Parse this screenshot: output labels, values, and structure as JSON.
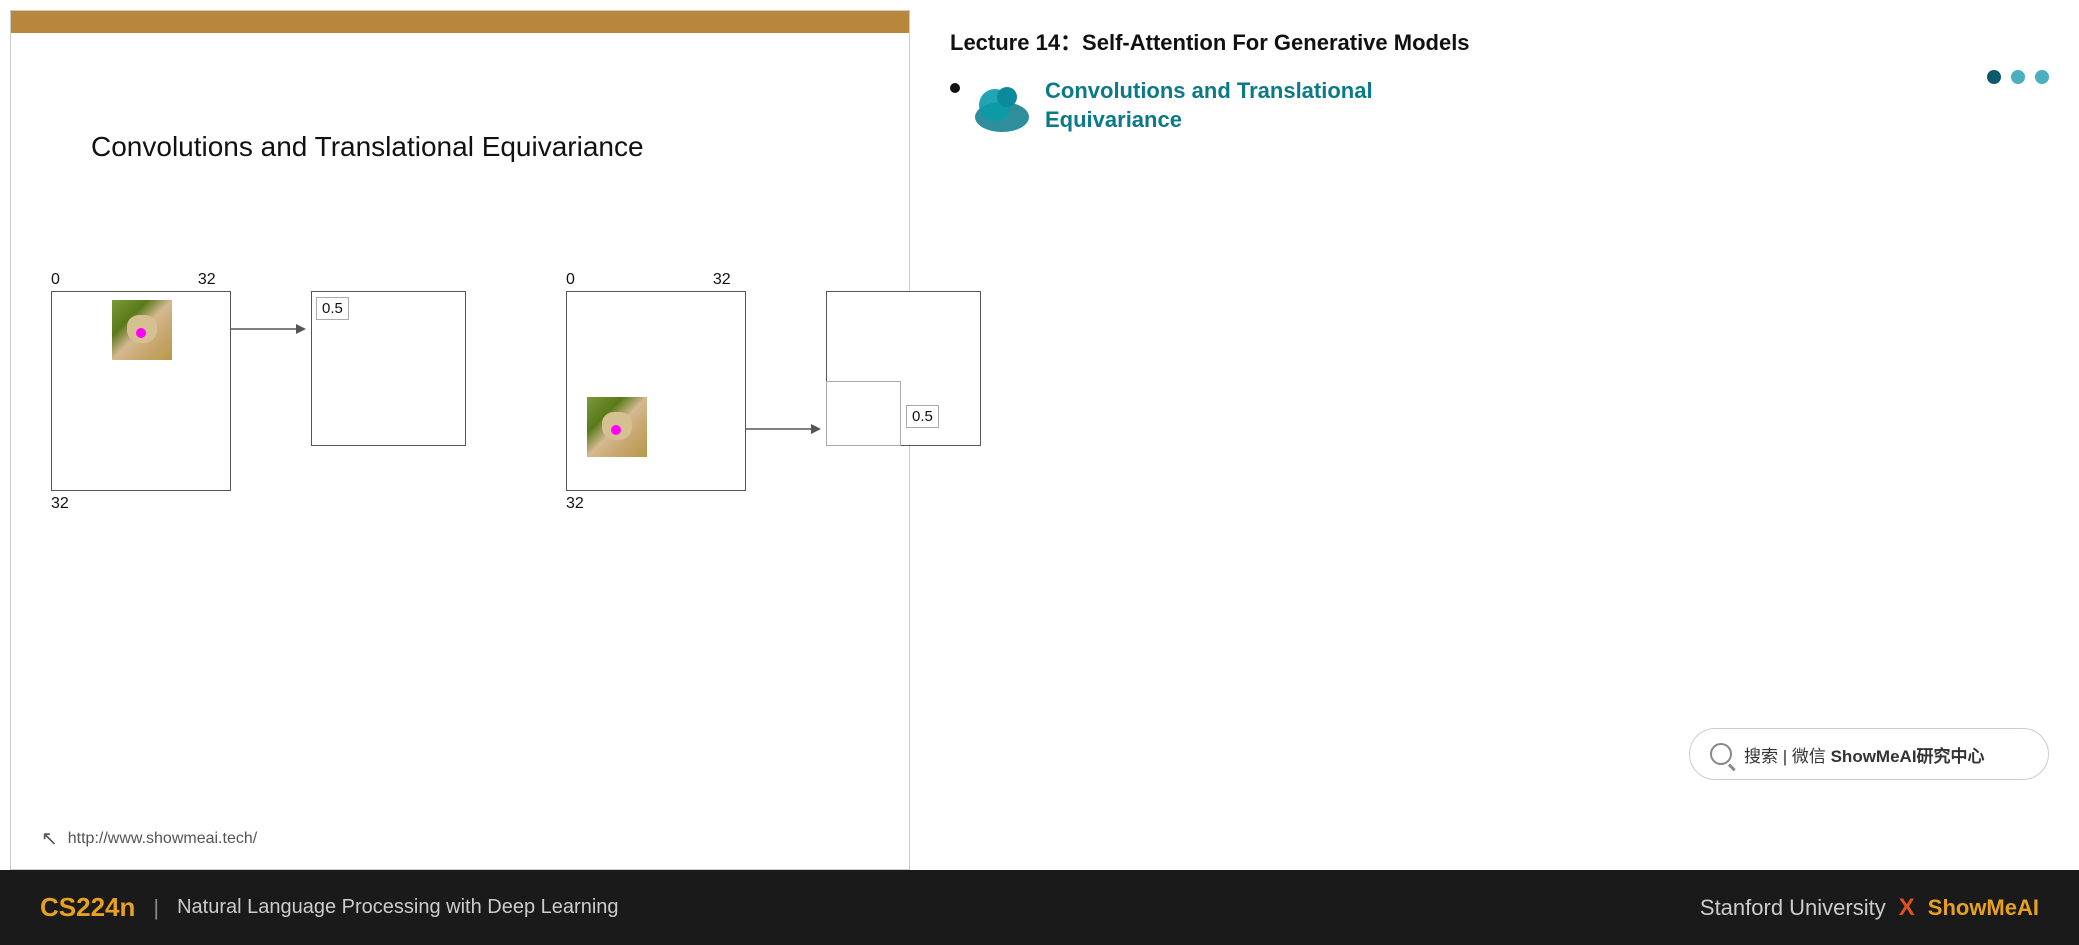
{
  "slide": {
    "top_bar_color": "#b8863c",
    "title": "Convolutions and Translational Equivariance",
    "diagram1": {
      "label0": "0",
      "label32_top": "32",
      "label32_bottom": "32",
      "value": "0.5",
      "dog_position": "top-right of left box"
    },
    "diagram2": {
      "label0": "0",
      "label32_top": "32",
      "label32_bottom": "32",
      "value": "0.5",
      "dog_position": "bottom-left of left box"
    },
    "footer_url": "http://www.showmeai.tech/"
  },
  "right_panel": {
    "lecture_title": "Lecture 14：Self-Attention For Generative Models",
    "toc_item_label": "Convolutions and Translational\nEquivariance",
    "nav_dots": [
      "active",
      "inactive",
      "inactive"
    ]
  },
  "search_box": {
    "placeholder": "搜索 | 微信 ShowMeAI研究中心",
    "icon": "search-icon"
  },
  "bottom_bar": {
    "course_code": "CS224n",
    "separator": "|",
    "course_name": "Natural Language Processing with Deep Learning",
    "right_text_prefix": "Stanford University",
    "x_mark": "X",
    "right_text_suffix": "ShowMeAI"
  }
}
